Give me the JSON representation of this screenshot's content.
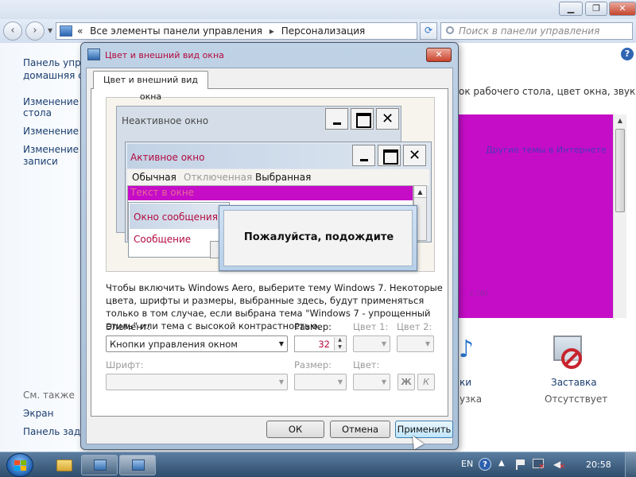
{
  "control_panel": {
    "address": {
      "prefix": "«",
      "crumb_1": "Все элементы панели управления",
      "crumb_2": "Персонализация",
      "separator": "▸"
    },
    "search_placeholder": "Поиск в панели управления",
    "sidebar": {
      "items": [
        {
          "label": "Панель упра"
        },
        {
          "label": "домашняя стра"
        },
        {
          "label": "Изменение з"
        },
        {
          "label": "стола"
        },
        {
          "label": "Изменение у"
        },
        {
          "label": "Изменение р"
        },
        {
          "label": "записи"
        }
      ],
      "see_also": "См. также",
      "links": [
        {
          "label": "Экран"
        },
        {
          "label": "Панель задач"
        }
      ]
    },
    "heading_text": "ок рабочего стола, цвет окна, звуки и",
    "theme_preview": {
      "color": "#c50dc8",
      "link_text": "Другие темы в Интернете",
      "faint_text": "с (6)"
    },
    "bottom_items": [
      {
        "label": "ки",
        "sublabel": "узка",
        "icon": "sound-icon"
      },
      {
        "label": "Заставка",
        "sublabel": "Отсутствует",
        "icon": "screensaver-icon"
      }
    ]
  },
  "dialog": {
    "title": "Цвет и внешний вид окна",
    "close_label": "✕",
    "tab_label": "Цвет и внешний вид окна",
    "preview": {
      "inactive_title": "Неактивное окно",
      "active_title": "Активное окно",
      "menu_normal": "Обычная",
      "menu_disabled": "Отключенная",
      "menu_selected": "Выбранная",
      "window_text": "Текст в окне",
      "message_title": "Окно сообщения",
      "message_text": "Сообщение",
      "close_glyph": "✕",
      "selection_color": "#c50dc8"
    },
    "please_wait": "Пожалуйста, подождите",
    "info_text": "Чтобы включить Windows Aero, выберите тему Windows 7. Некоторые цвета, шрифты и размеры, выбранные здесь, будут применяться только в том случае, если выбрана тема \"Windows 7 - упрощенный стиль\" или тема с высокой контрастностью.",
    "element_label": "Элемент:",
    "element_value": "Кнопки управления окном",
    "size_label": "Размер:",
    "size_value": "32",
    "color1_label": "Цвет 1:",
    "color2_label": "Цвет 2:",
    "font_label": "Шрифт:",
    "font_size_label": "Размер:",
    "font_color_label": "Цвет:",
    "bold_label": "Ж",
    "italic_label": "К",
    "buttons": {
      "ok": "ОК",
      "cancel": "Отмена",
      "apply": "Применить"
    }
  },
  "taskbar": {
    "language": "EN",
    "clock": "20:58"
  }
}
